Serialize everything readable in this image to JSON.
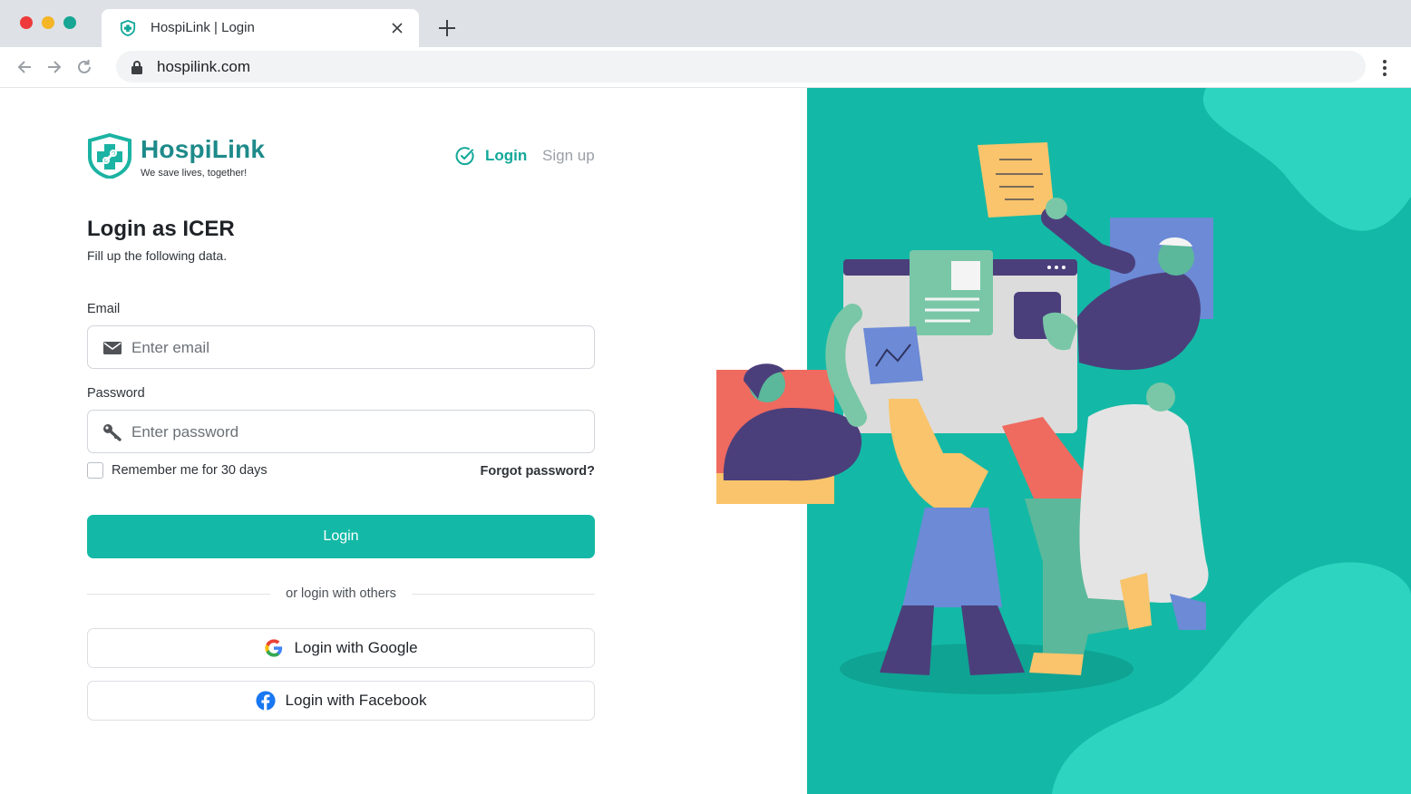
{
  "browser": {
    "tab_title": "HospiLink | Login",
    "url": "hospilink.com",
    "icons": [
      "shield-favicon-icon",
      "close-icon",
      "plus-icon",
      "back-arrow-icon",
      "forward-arrow-icon",
      "reload-icon",
      "lock-icon",
      "kebab-menu-icon"
    ]
  },
  "brand": {
    "name": "HospiLink",
    "tagline": "We save lives, together!",
    "accent": "#13b9a6",
    "logo_color": "#1e8a8a"
  },
  "topnav": {
    "login": "Login",
    "signup": "Sign up"
  },
  "form": {
    "title": "Login as ICER",
    "subtitle": "Fill up the following data.",
    "email_label": "Email",
    "email_placeholder": "Enter email",
    "email_value": "",
    "password_label": "Password",
    "password_placeholder": "Enter password",
    "password_value": "",
    "remember": "Remember me for 30 days",
    "remember_checked": false,
    "forgot": "Forgot password?",
    "submit": "Login",
    "divider": "or login with others",
    "google": "Login with Google",
    "facebook": "Login with Facebook"
  },
  "colors": {
    "panel_bg": "#13b9a6",
    "panel_blob": "#2dd4bf",
    "text_dark": "#1f2328",
    "muted": "#9aa0a6"
  }
}
